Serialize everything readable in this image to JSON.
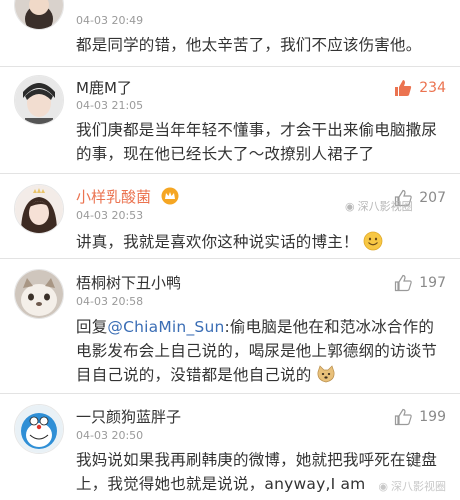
{
  "comments": [
    {
      "username": "",
      "time": "04-03 20:49",
      "text": "都是同学的错，他太辛苦了，我们不应该伤害他。",
      "likes": ""
    },
    {
      "username": "M鹿M了",
      "time": "04-03 21:05",
      "text": "我们庚都是当年年轻不懂事，才会干出来偷电脑撒尿的事，现在他已经长大了～改撩别人裙子了",
      "likes": "234"
    },
    {
      "username": "小样乳酸菌",
      "time": "04-03 20:53",
      "text": "讲真，我就是喜欢你这种说实话的博主！",
      "likes": "207"
    },
    {
      "username": "梧桐树下丑小鸭",
      "time": "04-03 20:58",
      "reply_prefix": "回复",
      "mention": "@ChiaMin_Sun",
      "text": ":偷电脑是他在和范冰冰合作的电影发布会上自己说的，喝尿是他上郭德纲的访谈节目自己说的，没错都是他自己说的",
      "likes": "197"
    },
    {
      "username": "一只颜狗蓝胖子",
      "time": "04-03 20:50",
      "text": "我妈说如果我再刷韩庚的微博，她就把我呼死在键盘上，我觉得她也就是说说，anyway,I am",
      "likes": "199"
    }
  ],
  "watermarks": {
    "primary": "深八影视圈",
    "secondary": "深八影视圈"
  },
  "colors": {
    "accent": "#eb7350",
    "mention": "#3b6eb5",
    "meta": "#9a9a9a",
    "divider": "#e3e3e3"
  },
  "icons": {
    "like": "thumbs-up-icon",
    "emoji_smile": "smile-emoji-icon",
    "emoji_doge": "doge-emoji-icon",
    "badge": "crown-badge-icon"
  }
}
